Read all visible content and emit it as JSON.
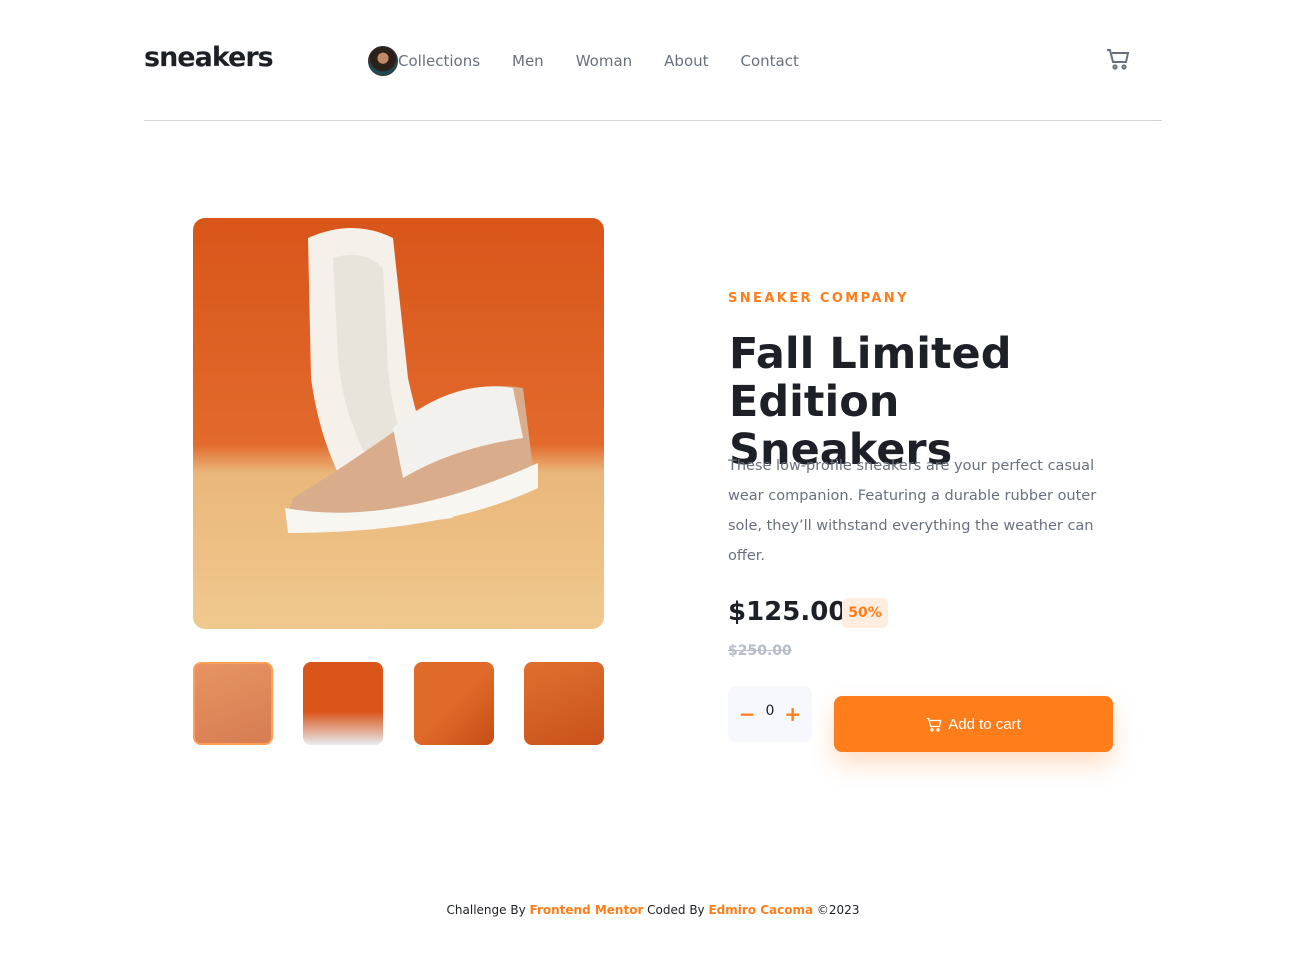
{
  "header": {
    "logo": "sneakers",
    "nav": [
      "Collections",
      "Men",
      "Woman",
      "About",
      "Contact"
    ]
  },
  "product": {
    "company": "SNEAKER COMPANY",
    "title": "Fall Limited Edition Sneakers",
    "description": "These low-profile sneakers are your perfect casual wear companion. Featuring a durable rubber outer sole, they’ll withstand everything the weather can offer.",
    "price": "$125.00",
    "discount": "50%",
    "old_price": "$250.00",
    "quantity": "0",
    "add_label": "Add to cart"
  },
  "footer": {
    "t1": "Challenge By ",
    "l1": "Frontend Mentor",
    "t2": " Coded By ",
    "l2": "Edmiro Cacoma",
    "t3": " ©2023"
  },
  "colors": {
    "accent": "#ff7e1b",
    "text": "#1d2026",
    "muted": "#69707d"
  }
}
